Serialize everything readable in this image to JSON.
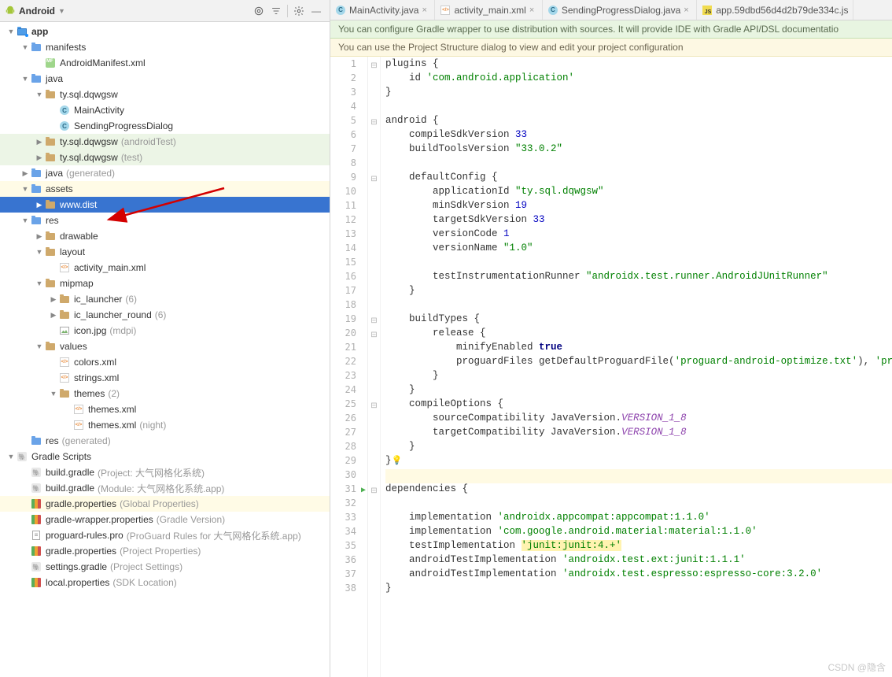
{
  "panel": {
    "title": "Android"
  },
  "tree": [
    {
      "d": 0,
      "arrow": "open",
      "icon": "module",
      "label": "app",
      "bold": true
    },
    {
      "d": 1,
      "arrow": "open",
      "icon": "folder-blue",
      "label": "manifests"
    },
    {
      "d": 2,
      "arrow": "",
      "icon": "manifest",
      "label": "AndroidManifest.xml"
    },
    {
      "d": 1,
      "arrow": "open",
      "icon": "folder-blue",
      "label": "java"
    },
    {
      "d": 2,
      "arrow": "open",
      "icon": "folder",
      "label": "ty.sql.dqwgsw"
    },
    {
      "d": 3,
      "arrow": "",
      "icon": "class",
      "label": "MainActivity"
    },
    {
      "d": 3,
      "arrow": "",
      "icon": "class",
      "label": "SendingProgressDialog"
    },
    {
      "d": 2,
      "arrow": "closed",
      "icon": "folder",
      "label": "ty.sql.dqwgsw",
      "suffix": "(androidTest)",
      "cls": "hl-green"
    },
    {
      "d": 2,
      "arrow": "closed",
      "icon": "folder",
      "label": "ty.sql.dqwgsw",
      "suffix": "(test)",
      "cls": "hl-green"
    },
    {
      "d": 1,
      "arrow": "closed",
      "icon": "folder-blue",
      "label": "java",
      "suffix": "(generated)"
    },
    {
      "d": 1,
      "arrow": "open",
      "icon": "folder-blue",
      "label": "assets",
      "cls": "hl-yellow"
    },
    {
      "d": 2,
      "arrow": "closed",
      "icon": "folder",
      "label": "www.dist",
      "cls": "selected"
    },
    {
      "d": 1,
      "arrow": "open",
      "icon": "folder-blue",
      "label": "res"
    },
    {
      "d": 2,
      "arrow": "closed",
      "icon": "folder",
      "label": "drawable"
    },
    {
      "d": 2,
      "arrow": "open",
      "icon": "folder",
      "label": "layout"
    },
    {
      "d": 3,
      "arrow": "",
      "icon": "xml",
      "label": "activity_main.xml"
    },
    {
      "d": 2,
      "arrow": "open",
      "icon": "folder",
      "label": "mipmap"
    },
    {
      "d": 3,
      "arrow": "closed",
      "icon": "folder",
      "label": "ic_launcher",
      "suffix": "(6)"
    },
    {
      "d": 3,
      "arrow": "closed",
      "icon": "folder",
      "label": "ic_launcher_round",
      "suffix": "(6)"
    },
    {
      "d": 3,
      "arrow": "",
      "icon": "img",
      "label": "icon.jpg",
      "suffix": "(mdpi)"
    },
    {
      "d": 2,
      "arrow": "open",
      "icon": "folder",
      "label": "values"
    },
    {
      "d": 3,
      "arrow": "",
      "icon": "xml",
      "label": "colors.xml"
    },
    {
      "d": 3,
      "arrow": "",
      "icon": "xml",
      "label": "strings.xml"
    },
    {
      "d": 3,
      "arrow": "open",
      "icon": "folder",
      "label": "themes",
      "suffix": "(2)"
    },
    {
      "d": 4,
      "arrow": "",
      "icon": "xml",
      "label": "themes.xml"
    },
    {
      "d": 4,
      "arrow": "",
      "icon": "xml",
      "label": "themes.xml",
      "suffix": "(night)"
    },
    {
      "d": 1,
      "arrow": "",
      "icon": "folder-blue",
      "label": "res",
      "suffix": "(generated)"
    },
    {
      "d": 0,
      "arrow": "open",
      "icon": "gradle",
      "label": "Gradle Scripts"
    },
    {
      "d": 1,
      "arrow": "",
      "icon": "gradle",
      "label": "build.gradle",
      "suffix": "(Project: 大气网格化系统)"
    },
    {
      "d": 1,
      "arrow": "",
      "icon": "gradle",
      "label": "build.gradle",
      "suffix": "(Module: 大气网格化系统.app)"
    },
    {
      "d": 1,
      "arrow": "",
      "icon": "prop",
      "label": "gradle.properties",
      "suffix": "(Global Properties)",
      "cls": "hl-yellow"
    },
    {
      "d": 1,
      "arrow": "",
      "icon": "prop",
      "label": "gradle-wrapper.properties",
      "suffix": "(Gradle Version)"
    },
    {
      "d": 1,
      "arrow": "",
      "icon": "txt",
      "label": "proguard-rules.pro",
      "suffix": "(ProGuard Rules for 大气网格化系统.app)"
    },
    {
      "d": 1,
      "arrow": "",
      "icon": "prop",
      "label": "gradle.properties",
      "suffix": "(Project Properties)"
    },
    {
      "d": 1,
      "arrow": "",
      "icon": "gradle",
      "label": "settings.gradle",
      "suffix": "(Project Settings)"
    },
    {
      "d": 1,
      "arrow": "",
      "icon": "prop",
      "label": "local.properties",
      "suffix": "(SDK Location)"
    }
  ],
  "tabs": [
    {
      "icon": "class",
      "label": "MainActivity.java",
      "close": true
    },
    {
      "icon": "xml",
      "label": "activity_main.xml",
      "close": true
    },
    {
      "icon": "class",
      "label": "SendingProgressDialog.java",
      "close": true
    },
    {
      "icon": "js",
      "label": "app.59dbd56d4d2b79de334c.js",
      "close": false
    }
  ],
  "banners": {
    "green": "You can configure Gradle wrapper to use distribution with sources. It will provide IDE with Gradle API/DSL documentatio",
    "yellow": "You can use the Project Structure dialog to view and edit your project configuration"
  },
  "code": {
    "lines": [
      [
        {
          "t": "plugins {",
          "c": ""
        }
      ],
      [
        {
          "t": "    id ",
          "c": ""
        },
        {
          "t": "'com.android.application'",
          "c": "tok-str"
        }
      ],
      [
        {
          "t": "}",
          "c": ""
        }
      ],
      [
        {
          "t": "",
          "c": ""
        }
      ],
      [
        {
          "t": "android {",
          "c": ""
        }
      ],
      [
        {
          "t": "    compileSdkVersion ",
          "c": ""
        },
        {
          "t": "33",
          "c": "tok-num"
        }
      ],
      [
        {
          "t": "    buildToolsVersion ",
          "c": ""
        },
        {
          "t": "\"33.0.2\"",
          "c": "tok-str"
        }
      ],
      [
        {
          "t": "",
          "c": ""
        }
      ],
      [
        {
          "t": "    defaultConfig {",
          "c": ""
        }
      ],
      [
        {
          "t": "        applicationId ",
          "c": ""
        },
        {
          "t": "\"ty.sql.dqwgsw\"",
          "c": "tok-str"
        }
      ],
      [
        {
          "t": "        minSdkVersion ",
          "c": ""
        },
        {
          "t": "19",
          "c": "tok-num"
        }
      ],
      [
        {
          "t": "        targetSdkVersion ",
          "c": ""
        },
        {
          "t": "33",
          "c": "tok-num"
        }
      ],
      [
        {
          "t": "        versionCode ",
          "c": ""
        },
        {
          "t": "1",
          "c": "tok-num"
        }
      ],
      [
        {
          "t": "        versionName ",
          "c": ""
        },
        {
          "t": "\"1.0\"",
          "c": "tok-str"
        }
      ],
      [
        {
          "t": "",
          "c": ""
        }
      ],
      [
        {
          "t": "        testInstrumentationRunner ",
          "c": ""
        },
        {
          "t": "\"androidx.test.runner.AndroidJUnitRunner\"",
          "c": "tok-str"
        }
      ],
      [
        {
          "t": "    }",
          "c": ""
        }
      ],
      [
        {
          "t": "",
          "c": ""
        }
      ],
      [
        {
          "t": "    buildTypes {",
          "c": ""
        }
      ],
      [
        {
          "t": "        release {",
          "c": ""
        }
      ],
      [
        {
          "t": "            minifyEnabled ",
          "c": ""
        },
        {
          "t": "true",
          "c": "tok-bool"
        }
      ],
      [
        {
          "t": "            proguardFiles getDefaultProguardFile(",
          "c": ""
        },
        {
          "t": "'proguard-android-optimize.txt'",
          "c": "tok-str"
        },
        {
          "t": "), ",
          "c": ""
        },
        {
          "t": "'proguard-",
          "c": "tok-str"
        }
      ],
      [
        {
          "t": "        }",
          "c": ""
        }
      ],
      [
        {
          "t": "    }",
          "c": ""
        }
      ],
      [
        {
          "t": "    compileOptions {",
          "c": ""
        }
      ],
      [
        {
          "t": "        sourceCompatibility JavaVersion.",
          "c": ""
        },
        {
          "t": "VERSION_1_8",
          "c": "tok-const"
        }
      ],
      [
        {
          "t": "        targetCompatibility JavaVersion.",
          "c": ""
        },
        {
          "t": "VERSION_1_8",
          "c": "tok-const"
        }
      ],
      [
        {
          "t": "    }",
          "c": ""
        }
      ],
      [
        {
          "t": "}",
          "c": ""
        },
        {
          "t": "💡",
          "c": "bulb"
        }
      ],
      [
        {
          "t": "",
          "c": ""
        }
      ],
      [
        {
          "t": "dependencies {",
          "c": ""
        }
      ],
      [
        {
          "t": "",
          "c": ""
        }
      ],
      [
        {
          "t": "    implementation ",
          "c": ""
        },
        {
          "t": "'androidx.appcompat:appcompat:1.1.0'",
          "c": "tok-str"
        }
      ],
      [
        {
          "t": "    implementation ",
          "c": ""
        },
        {
          "t": "'com.google.android.material:material:1.1.0'",
          "c": "tok-str"
        }
      ],
      [
        {
          "t": "    testImplementation ",
          "c": ""
        },
        {
          "t": "'junit:junit:4.+'",
          "c": "tok-str tok-warn"
        }
      ],
      [
        {
          "t": "    androidTestImplementation ",
          "c": ""
        },
        {
          "t": "'androidx.test.ext:junit:1.1.1'",
          "c": "tok-str"
        }
      ],
      [
        {
          "t": "    androidTestImplementation ",
          "c": ""
        },
        {
          "t": "'androidx.test.espresso:espresso-core:3.2.0'",
          "c": "tok-str"
        }
      ],
      [
        {
          "t": "}",
          "c": ""
        }
      ]
    ],
    "fold": [
      1,
      5,
      9,
      19,
      20,
      25,
      31
    ],
    "run_mark_line": 31,
    "hl_line": 30
  },
  "watermark": "CSDN @隐含"
}
